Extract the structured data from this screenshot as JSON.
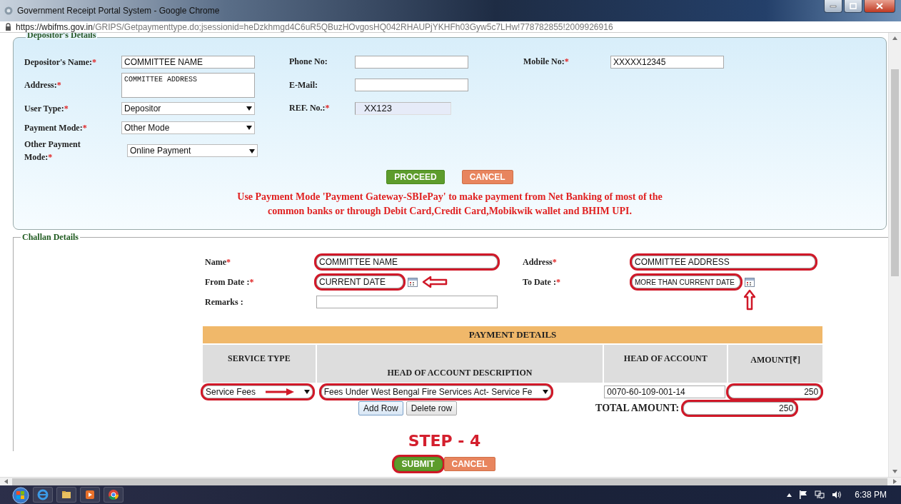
{
  "browser": {
    "title": "Government Receipt Portal System - Google Chrome",
    "url_host": "https://wbifms.gov.in",
    "url_path": "/GRIPS/Getpaymenttype.do;jsessionid=heDzkhmgd4C6uR5QBuzHOvgosHQ042RHAUPjYKHFh03Gyw5c7LHw!778782855!2009926916"
  },
  "depositor": {
    "legend": "Depositor's Details",
    "rows": [
      [
        {
          "label": "Depositor's Name:",
          "mark": "*",
          "kind": "text",
          "value": "COMMITTEE NAME"
        },
        {
          "label": "Phone No:",
          "kind": "text"
        },
        {
          "label": "Mobile No:",
          "mark": "*",
          "kind": "text",
          "value": "XXXXX12345"
        }
      ],
      [
        {
          "label": "Address:",
          "mark": "*",
          "kind": "textarea",
          "value": "COMMITTEE ADDRESS"
        },
        {
          "label": "E-Mail:",
          "kind": "text"
        }
      ],
      [
        {
          "label": "User Type:",
          "mark": "*",
          "kind": "select",
          "value": "Depositor"
        },
        {
          "label": "REF. No.:",
          "mark": "*",
          "kind": "readonly",
          "value": "XX123"
        }
      ],
      [
        {
          "label": "Payment Mode:",
          "mark": "*",
          "kind": "select",
          "value": "Other Mode"
        }
      ],
      [
        {
          "label": "Other Payment Mode:",
          "mark": "*",
          "kind": "select",
          "value": "Online Payment"
        }
      ]
    ],
    "buttons": [
      {
        "label": "PROCEED",
        "kind": "primary",
        "highlighted": false
      },
      {
        "label": "CANCEL",
        "kind": "secondary",
        "highlighted": false
      }
    ],
    "notice": [
      "Use Payment Mode 'Payment Gateway-SBIePay' to make payment from Net Banking of most of the",
      "common banks or through Debit Card,Credit Card,Mobikwik wallet and BHIM UPI."
    ]
  },
  "challan": {
    "legend": "Challan Details",
    "rows": [
      [
        {
          "label": "Name",
          "mark": "*",
          "kind": "text",
          "value": "COMMITTEE NAME",
          "highlighted": true
        },
        {
          "label": "Address",
          "mark": "*",
          "kind": "text",
          "value": "COMMITTEE ADDRESS",
          "highlighted": true
        }
      ],
      [
        {
          "label": "From Date :",
          "mark": "*",
          "kind": "date",
          "value": "CURRENT DATE",
          "highlighted": true,
          "left_arrow": true
        },
        {
          "label": "To Date :",
          "mark": "*",
          "kind": "date",
          "value": "MORE THAN CURRENT DATE",
          "highlighted": true,
          "up_arrow": true
        }
      ],
      [
        {
          "label": "Remarks :",
          "kind": "text"
        }
      ]
    ]
  },
  "payment": {
    "title": "PAYMENT DETAILS",
    "columns": [
      "SERVICE TYPE",
      "HEAD OF ACCOUNT DESCRIPTION",
      "HEAD OF ACCOUNT",
      "AMOUNT[₹]"
    ],
    "rows": [
      {
        "service_type": {
          "value": "Service Fees",
          "highlighted": true,
          "right_arrow": true
        },
        "description": {
          "value": "Fees Under West Bengal Fire Services Act- Service Fe",
          "highlighted": true
        },
        "head_of_account": "0070-60-109-001-14",
        "amount": {
          "value": "250",
          "highlighted": true
        }
      }
    ],
    "row_buttons": [
      "Add Row",
      "Delete row"
    ],
    "total_label": "TOTAL AMOUNT:",
    "total": {
      "value": "250",
      "highlighted": true
    }
  },
  "step": {
    "label": "STEP - 4",
    "buttons": [
      {
        "label": "SUBMIT",
        "kind": "primary",
        "highlighted": true
      },
      {
        "label": "CANCEL",
        "kind": "secondary",
        "highlighted": false
      }
    ]
  },
  "taskbar": {
    "clock": "6:38 PM"
  }
}
